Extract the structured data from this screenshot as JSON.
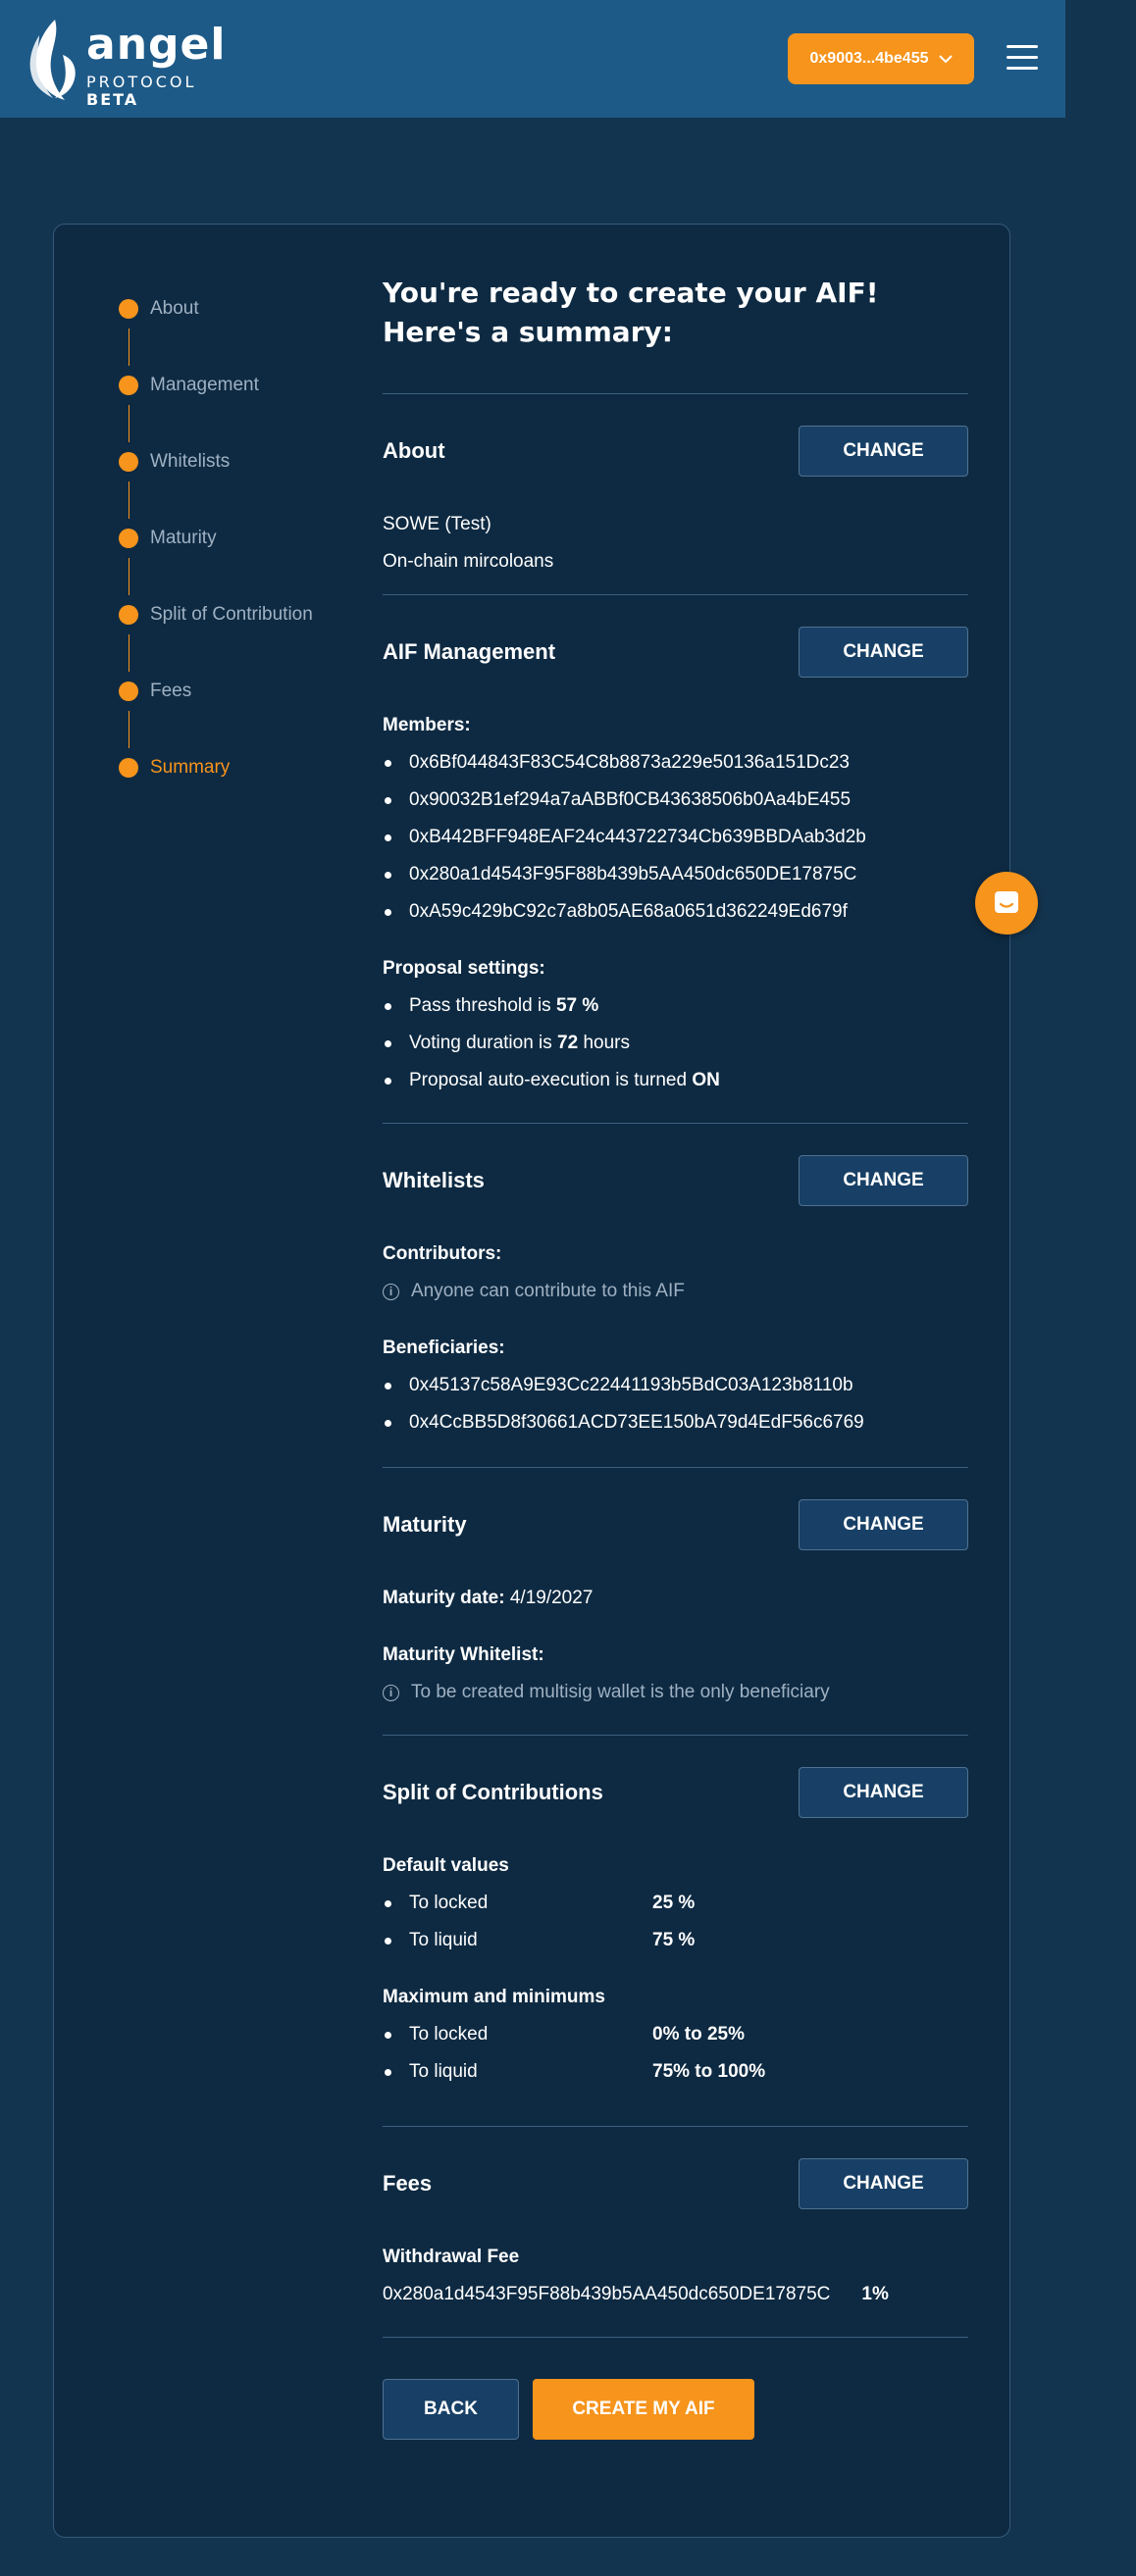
{
  "header": {
    "logo_word": "angel",
    "logo_sub": "PROTOCOL",
    "logo_beta": "BETA",
    "wallet_label": "0x9003...4be455",
    "menu_icon": "hamburger-icon",
    "colors": {
      "header_bg": "#1d5a88",
      "accent": "#f6941c"
    }
  },
  "steps": [
    {
      "label": "About"
    },
    {
      "label": "Management"
    },
    {
      "label": "Whitelists"
    },
    {
      "label": "Maturity"
    },
    {
      "label": "Split of Contribution"
    },
    {
      "label": "Fees"
    },
    {
      "label": "Summary"
    }
  ],
  "active_step": "Summary",
  "summary": {
    "title": "You're ready to create your AIF! Here's a summary:",
    "change_label": "CHANGE",
    "about": {
      "title": "About",
      "name": "SOWE (Test)",
      "description": "On-chain mircoloans"
    },
    "management": {
      "title": "AIF Management",
      "members_label": "Members:",
      "members": [
        "0x6Bf044843F83C54C8b8873a229e50136a151Dc23",
        "0x90032B1ef294a7aABBf0CB43638506b0Aa4bE455",
        "0xB442BFF948EAF24c443722734Cb639BBDAab3d2b",
        "0x280a1d4543F95F88b439b5AA450dc650DE17875C",
        "0xA59c429bC92c7a8b05AE68a0651d362249Ed679f"
      ],
      "proposal_label": "Proposal settings:",
      "threshold_prefix": "Pass threshold is ",
      "threshold_value": "57 %",
      "duration_prefix": "Voting duration is ",
      "duration_value": "72",
      "duration_suffix": " hours",
      "autoexec_prefix": "Proposal auto-execution is turned ",
      "autoexec_value": "ON"
    },
    "whitelists": {
      "title": "Whitelists",
      "contributors_label": "Contributors:",
      "contributors_info": "Anyone can contribute to this AIF",
      "beneficiaries_label": "Beneficiaries:",
      "beneficiaries": [
        "0x45137c58A9E93Cc22441193b5BdC03A123b8110b",
        "0x4CcBB5D8f30661ACD73EE150bA79d4EdF56c6769"
      ]
    },
    "maturity": {
      "title": "Maturity",
      "date_label": "Maturity date:",
      "date_value": "4/19/2027",
      "whitelist_label": "Maturity Whitelist:",
      "whitelist_info": "To be created multisig wallet is the only beneficiary"
    },
    "split": {
      "title": "Split of Contributions",
      "defaults_label": "Default values",
      "defaults": [
        {
          "key": "To locked",
          "value": "25 %"
        },
        {
          "key": "To liquid",
          "value": "75 %"
        }
      ],
      "limits_label": "Maximum and minimums",
      "limits": [
        {
          "key": "To locked",
          "value": "0% to 25%"
        },
        {
          "key": "To liquid",
          "value": "75% to 100%"
        }
      ]
    },
    "fees": {
      "title": "Fees",
      "withdrawal_label": "Withdrawal Fee",
      "withdrawal_address": "0x280a1d4543F95F88b439b5AA450dc650DE17875C",
      "withdrawal_value": "1%"
    },
    "back_label": "BACK",
    "create_label": "CREATE MY AIF"
  },
  "chat_icon": "chat-icon"
}
